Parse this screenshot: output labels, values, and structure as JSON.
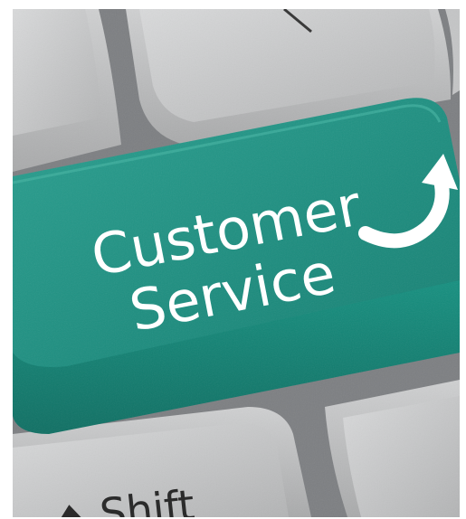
{
  "key_label": {
    "line1": "Customer",
    "line2": "Service"
  },
  "shift_key_label": "Shift",
  "colors": {
    "key_green": "#1f8f82",
    "key_green_dark": "#137266",
    "key_gray": "#b8b9ba",
    "key_gray_light": "#d3d4d5",
    "gap_dark": "#6b6d70",
    "label_white": "#ffffff"
  },
  "icons": {
    "arrow": "curved-up-arrow-icon"
  }
}
